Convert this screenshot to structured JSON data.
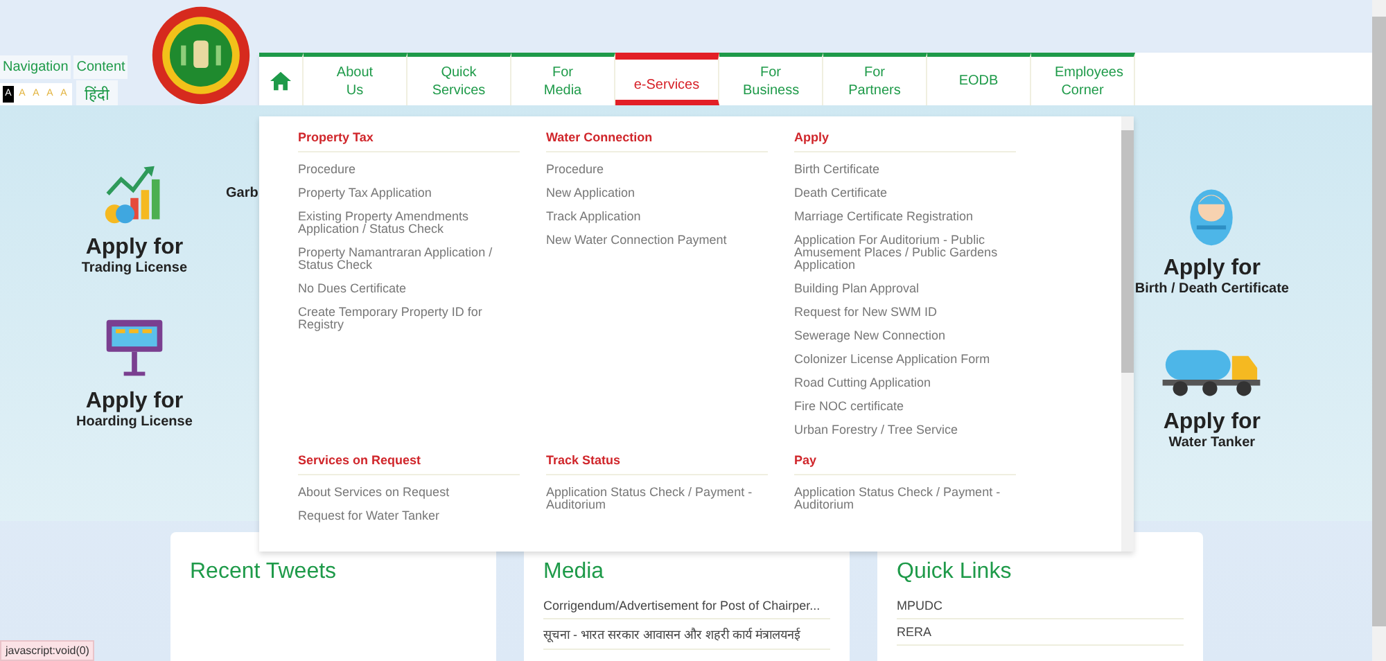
{
  "accessibility": {
    "tabs": [
      "Navigation",
      "Content"
    ],
    "font_sizes": [
      {
        "label": "A",
        "selected": true
      },
      {
        "label": "A",
        "selected": false
      },
      {
        "label": "A",
        "selected": false
      },
      {
        "label": "A",
        "selected": false
      },
      {
        "label": "A",
        "selected": false
      }
    ],
    "language": "हिंदी"
  },
  "nav": {
    "items": [
      {
        "label": "About Us",
        "selected": false
      },
      {
        "label": "Quick Services",
        "selected": false
      },
      {
        "label": "For Media",
        "selected": false
      },
      {
        "label": "e-Services",
        "selected": true
      },
      {
        "label": "For Business",
        "selected": false
      },
      {
        "label": "For Partners",
        "selected": false
      },
      {
        "label": "EODB",
        "selected": false
      },
      {
        "label": "Employees Corner",
        "selected": false
      }
    ]
  },
  "mega_menu": {
    "sections": [
      {
        "title": "Property Tax",
        "items": [
          "Procedure",
          "Property Tax Application",
          "Existing Property Amendments Application / Status Check",
          "Property Namantraran Application / Status Check",
          "No Dues Certificate",
          "Create Temporary Property ID for Registry"
        ]
      },
      {
        "title": "Water Connection",
        "items": [
          "Procedure",
          "New Application",
          "Track Application",
          "New Water Connection Payment"
        ]
      },
      {
        "title": "Apply",
        "items": [
          "Birth Certificate",
          "Death Certificate",
          "Marriage Certificate Registration",
          "Application For Auditorium - Public Amusement Places / Public Gardens Application",
          "Building Plan Approval",
          "Request for New SWM ID",
          "Sewerage New Connection",
          "Colonizer License Application Form",
          "Road Cutting Application",
          "Fire NOC certificate",
          "Urban Forestry / Tree Service"
        ]
      },
      {
        "title": "Services on Request",
        "items": [
          "About Services on Request",
          "Request for Water Tanker"
        ]
      },
      {
        "title": "Track Status",
        "items": [
          "Application Status Check / Payment - Auditorium"
        ]
      },
      {
        "title": "Pay",
        "items": [
          "Application Status Check / Payment - Auditorium"
        ]
      }
    ]
  },
  "hero": {
    "left": [
      {
        "kind": "trading",
        "title": "Apply for",
        "subtitle": "Trading License"
      },
      {
        "kind": "hoarding",
        "title": "Apply for",
        "subtitle": "Hoarding License"
      }
    ],
    "partial_label": "Garb",
    "right": [
      {
        "kind": "baby",
        "title": "Apply for",
        "subtitle": "Birth / Death Certificate"
      },
      {
        "kind": "tanker",
        "title": "Apply for",
        "subtitle": "Water Tanker"
      }
    ]
  },
  "cards": [
    {
      "title": "Recent Tweets"
    },
    {
      "title": "Media",
      "items": [
        "Corrigendum/Advertisement for Post of Chairper...",
        "सूचना - भारत सरकार आवासन और शहरी कार्य मंत्रालयनई"
      ]
    },
    {
      "title": "Quick Links",
      "items": [
        "MPUDC",
        "RERA"
      ]
    }
  ],
  "status_tooltip": "javascript:void(0)"
}
